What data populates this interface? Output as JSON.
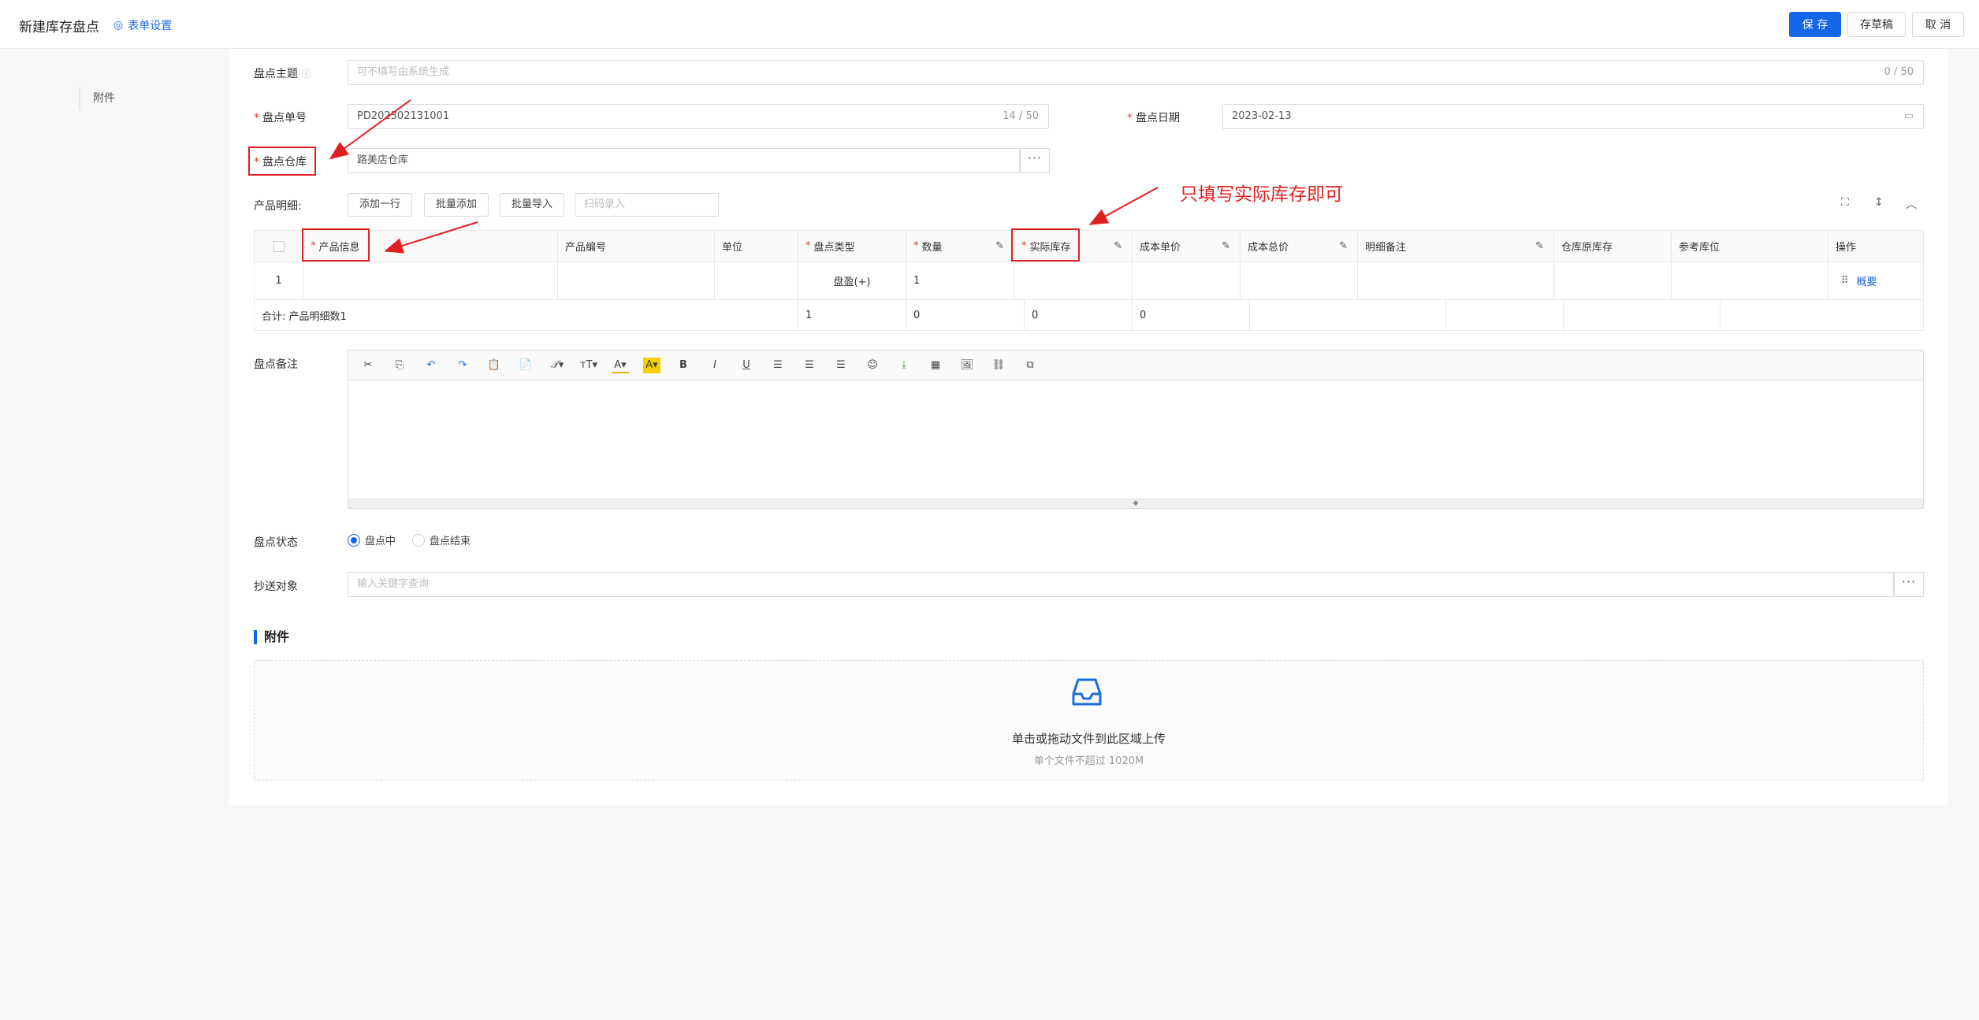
{
  "header": {
    "title": "新建库存盘点",
    "form_settings": "表单设置",
    "save": "保 存",
    "draft": "存草稿",
    "cancel": "取 消"
  },
  "sidebar": {
    "attachments_link": "附件"
  },
  "form": {
    "subject": {
      "label": "盘点主题",
      "placeholder": "可不填写由系统生成",
      "counter": "0 / 50"
    },
    "number": {
      "label": "盘点单号",
      "value": "PD202302131001",
      "counter": "14 / 50"
    },
    "date": {
      "label": "盘点日期",
      "value": "2023-02-13"
    },
    "warehouse": {
      "label": "盘点仓库",
      "value": "路美店仓库"
    },
    "details": {
      "label": "产品明细:",
      "add_row": "添加一行",
      "batch_add": "批量添加",
      "batch_import": "批量导入",
      "scan_placeholder": "扫码录入"
    },
    "table": {
      "columns": [
        "产品信息",
        "产品编号",
        "单位",
        "盘点类型",
        "数量",
        "实际库存",
        "成本单价",
        "成本总价",
        "明细备注",
        "仓库原库存",
        "参考库位",
        "操作"
      ],
      "rows": [
        {
          "index": "1",
          "product_info": "",
          "product_code": "",
          "unit": "",
          "type": "盘盈(+)",
          "quantity": "1",
          "actual_stock": "",
          "unit_cost": "",
          "total_cost": "",
          "remark": "",
          "original_stock": "",
          "location": "",
          "action": "概要"
        }
      ],
      "summary": {
        "label": "合计:  产品明细数1",
        "quantity": "1",
        "actual_stock": "0",
        "unit_cost": "0",
        "total_cost": "0"
      }
    },
    "remark": {
      "label": "盘点备注"
    },
    "status": {
      "label": "盘点状态",
      "options": [
        "盘点中",
        "盘点结束"
      ],
      "selected": "盘点中"
    },
    "cc": {
      "label": "抄送对象",
      "placeholder": "输入关键字查询"
    }
  },
  "attachments": {
    "title": "附件",
    "upload_text": "单击或拖动文件到此区域上传",
    "upload_hint": "单个文件不超过 1020M"
  },
  "annotation": {
    "note": "只填写实际库存即可",
    "color": "#e02020"
  },
  "colors": {
    "primary": "#1565e8",
    "required": "#e53935"
  }
}
